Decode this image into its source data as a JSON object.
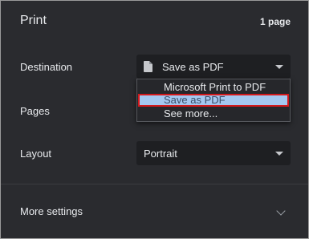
{
  "dialog": {
    "title": "Print",
    "page_count": "1 page"
  },
  "destination": {
    "label": "Destination",
    "selected": "Save as PDF",
    "icon": "document-icon",
    "options": [
      "Microsoft Print to PDF",
      "Save as PDF",
      "See more..."
    ],
    "highlighted_option": "Save as PDF"
  },
  "pages": {
    "label": "Pages"
  },
  "layout": {
    "label": "Layout",
    "selected": "Portrait"
  },
  "more_settings": {
    "label": "More settings",
    "icon": "chevron-down-icon"
  },
  "colors": {
    "panel_bg": "#2a2b2f",
    "select_bg": "#1e1f22",
    "highlight_bg": "#a4c8f0",
    "highlight_border": "#d3191c"
  }
}
